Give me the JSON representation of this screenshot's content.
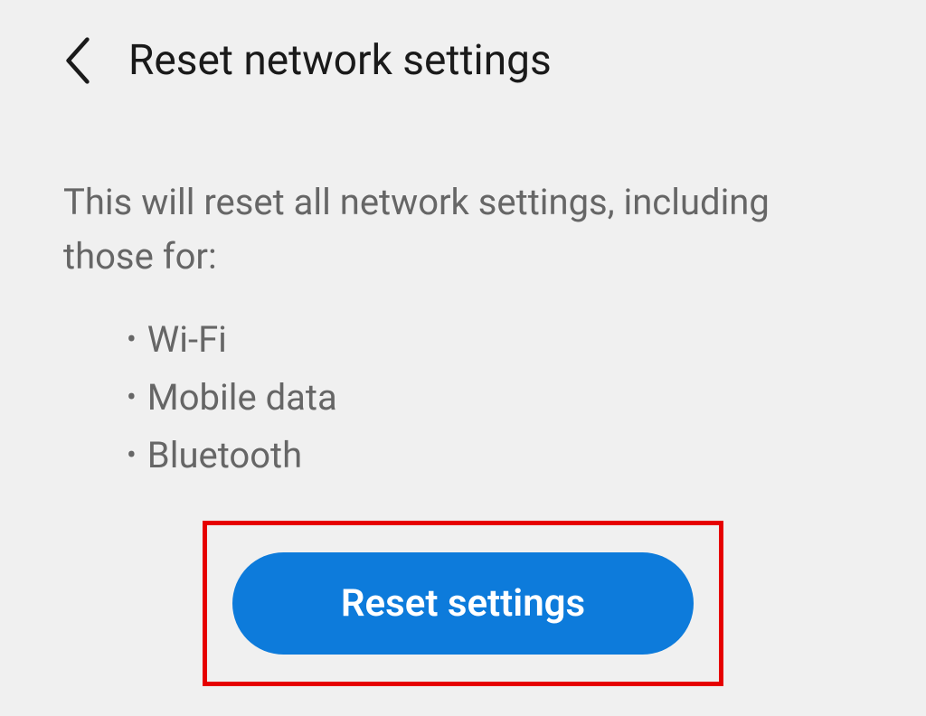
{
  "header": {
    "title": "Reset network settings"
  },
  "content": {
    "description": "This will reset all network settings, including those for:",
    "items": [
      "Wi-Fi",
      "Mobile data",
      "Bluetooth"
    ]
  },
  "action": {
    "reset_button_label": "Reset settings"
  },
  "colors": {
    "primary": "#0d7bdb",
    "highlight": "#e60000"
  }
}
